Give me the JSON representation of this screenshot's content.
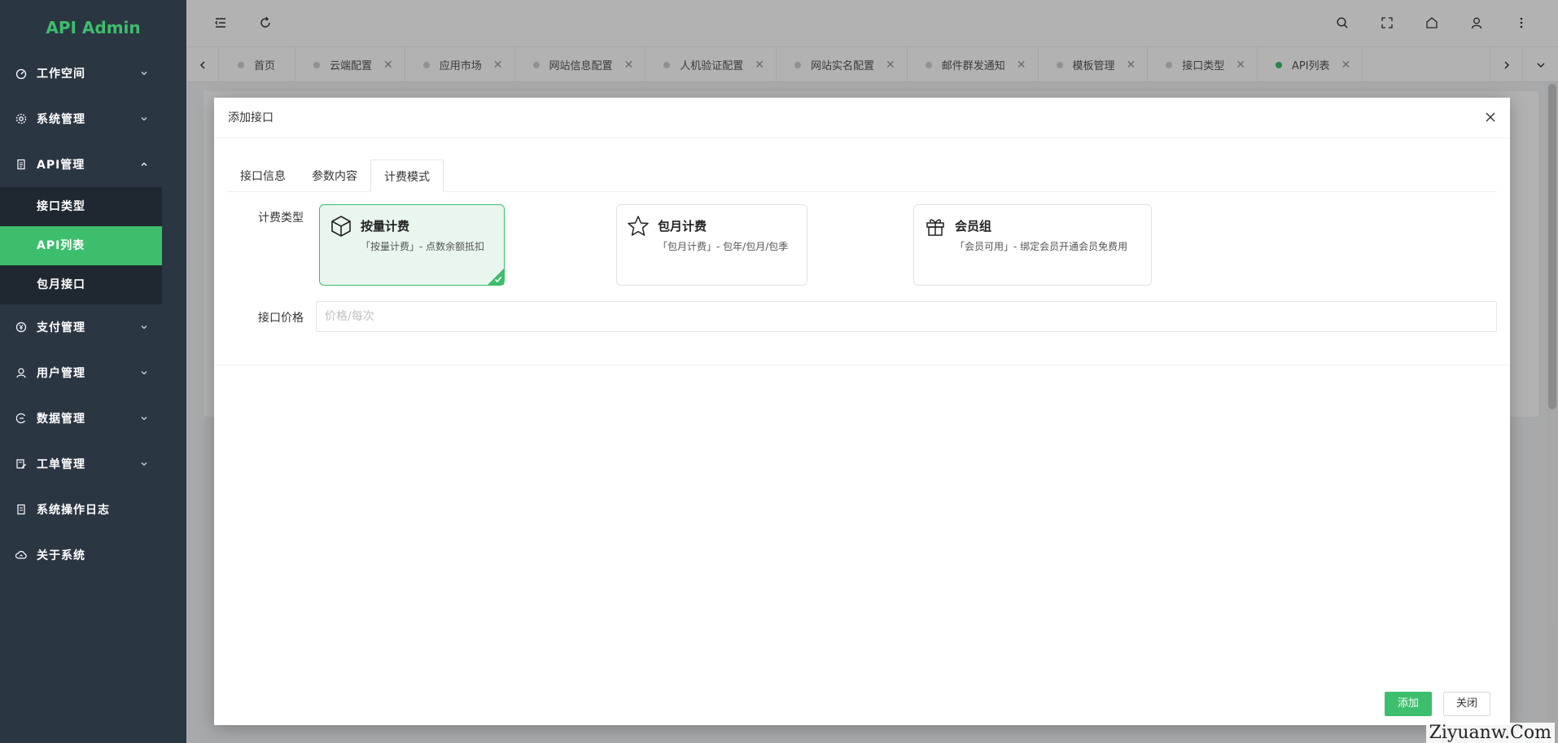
{
  "app": {
    "title": "API Admin",
    "accent": "#3dbe6c",
    "sidebar_bg": "#2b3643"
  },
  "sidebar": {
    "items": [
      {
        "label": "工作空间",
        "icon": "dashboard-icon",
        "expanded": false
      },
      {
        "label": "系统管理",
        "icon": "gear-icon",
        "expanded": false
      },
      {
        "label": "API管理",
        "icon": "document-icon",
        "expanded": true,
        "children": [
          {
            "label": "接口类型",
            "active": false
          },
          {
            "label": "API列表",
            "active": true
          },
          {
            "label": "包月接口",
            "active": false
          }
        ]
      },
      {
        "label": "支付管理",
        "icon": "yen-icon",
        "expanded": false
      },
      {
        "label": "用户管理",
        "icon": "user-icon",
        "expanded": false
      },
      {
        "label": "数据管理",
        "icon": "data-icon",
        "expanded": false
      },
      {
        "label": "工单管理",
        "icon": "ticket-icon",
        "expanded": false
      },
      {
        "label": "系统操作日志",
        "icon": "log-icon"
      },
      {
        "label": "关于系统",
        "icon": "cloud-icon"
      }
    ]
  },
  "header": {
    "icons": [
      "menu-fold-icon",
      "refresh-icon",
      "search-icon",
      "fullscreen-icon",
      "home-icon",
      "user-icon",
      "more-icon"
    ]
  },
  "tabs": [
    {
      "label": "首页",
      "active": false,
      "closable": false
    },
    {
      "label": "云端配置",
      "active": false,
      "closable": true
    },
    {
      "label": "应用市场",
      "active": false,
      "closable": true
    },
    {
      "label": "网站信息配置",
      "active": false,
      "closable": true
    },
    {
      "label": "人机验证配置",
      "active": false,
      "closable": true
    },
    {
      "label": "网站实名配置",
      "active": false,
      "closable": true
    },
    {
      "label": "邮件群发通知",
      "active": false,
      "closable": true
    },
    {
      "label": "模板管理",
      "active": false,
      "closable": true
    },
    {
      "label": "接口类型",
      "active": false,
      "closable": true
    },
    {
      "label": "API列表",
      "active": true,
      "closable": true
    }
  ],
  "modal": {
    "title": "添加接口",
    "tabs": [
      {
        "label": "接口信息",
        "active": false
      },
      {
        "label": "参数内容",
        "active": false
      },
      {
        "label": "计费模式",
        "active": true
      }
    ],
    "billing_type_label": "计费类型",
    "billing_options": [
      {
        "title": "按量计费",
        "desc": "「按量计费」- 点数余额抵扣",
        "icon": "cube-icon",
        "selected": true
      },
      {
        "title": "包月计费",
        "desc": "「包月计费」- 包年/包月/包季",
        "icon": "star-icon",
        "selected": false
      },
      {
        "title": "会员组",
        "desc": "「会员可用」- 绑定会员开通会员免费用",
        "icon": "gift-icon",
        "selected": false
      }
    ],
    "price_label": "接口价格",
    "price_value": "",
    "price_placeholder": "价格/每次",
    "submit_label": "添加",
    "close_label": "关闭"
  },
  "watermark": "Ziyuanw.Com"
}
